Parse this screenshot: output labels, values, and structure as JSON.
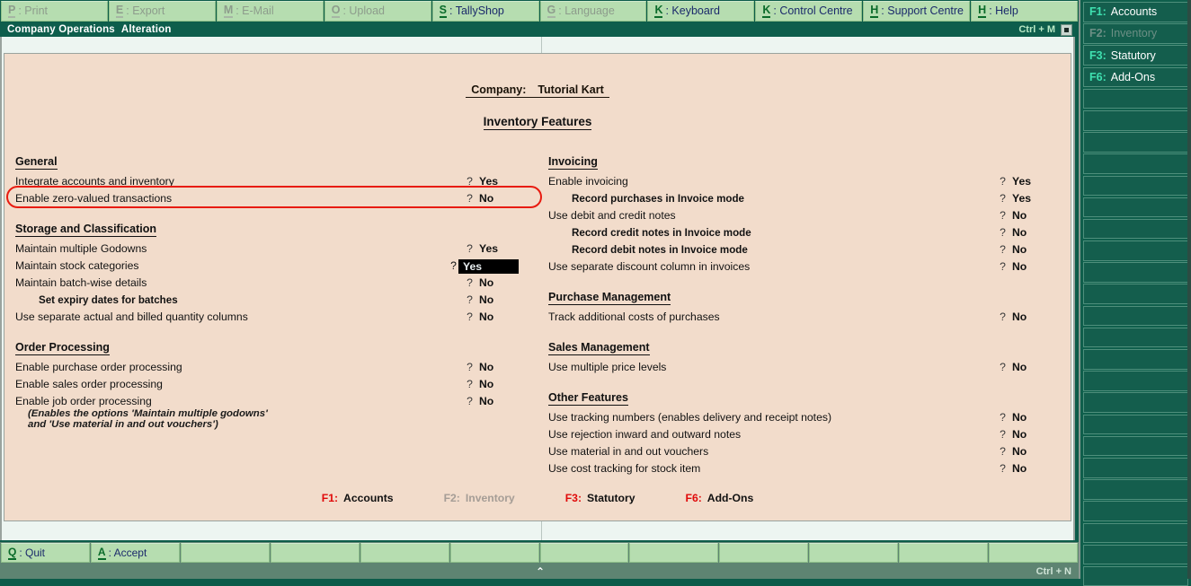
{
  "menubar": [
    {
      "acc": "P",
      "rest": ": Print",
      "enabled": false
    },
    {
      "acc": "E",
      "rest": ": Export",
      "enabled": false
    },
    {
      "acc": "M",
      "rest": ": E-Mail",
      "enabled": false
    },
    {
      "acc": "O",
      "rest": ": Upload",
      "enabled": false
    },
    {
      "acc": "S",
      "rest": ": TallyShop",
      "enabled": true
    },
    {
      "acc": "G",
      "rest": ": Language",
      "enabled": false
    },
    {
      "acc": "K",
      "rest": ": Keyboard",
      "enabled": true
    },
    {
      "acc": "K",
      "rest": ": Control Centre",
      "enabled": true
    },
    {
      "acc": "H",
      "rest": ": Support Centre",
      "enabled": true
    },
    {
      "acc": "H",
      "rest": ": Help",
      "enabled": true
    }
  ],
  "titlebar": {
    "title_part1": "Company Operations",
    "title_part2": "Alteration",
    "shortcut": "Ctrl + M"
  },
  "header": {
    "company_label": "Company:",
    "company_name": "Tutorial Kart",
    "page_title": "Inventory Features"
  },
  "left_column": [
    {
      "kind": "section",
      "label": "General"
    },
    {
      "kind": "row",
      "label": "Integrate accounts and inventory",
      "value": "Yes"
    },
    {
      "kind": "row",
      "label": "Enable zero-valued transactions",
      "value": "No"
    },
    {
      "kind": "gap"
    },
    {
      "kind": "section",
      "label": "Storage and Classification"
    },
    {
      "kind": "row",
      "label": "Maintain multiple Godowns",
      "value": "Yes"
    },
    {
      "kind": "row",
      "label": "Maintain stock categories",
      "value": "Yes",
      "selected": true
    },
    {
      "kind": "row",
      "label": "Maintain batch-wise details",
      "value": "No"
    },
    {
      "kind": "row",
      "label": "Set expiry dates for batches",
      "value": "No",
      "indent": true
    },
    {
      "kind": "row",
      "label": "Use separate actual and billed quantity columns",
      "value": "No"
    },
    {
      "kind": "gap"
    },
    {
      "kind": "section",
      "label": "Order Processing"
    },
    {
      "kind": "row",
      "label": "Enable purchase order processing",
      "value": "No"
    },
    {
      "kind": "row",
      "label": "Enable sales order processing",
      "value": "No"
    },
    {
      "kind": "row",
      "label": "Enable job order processing",
      "value": "No"
    },
    {
      "kind": "note",
      "label": "(Enables the options 'Maintain multiple godowns'"
    },
    {
      "kind": "note",
      "label": "and 'Use material in and out vouchers')"
    }
  ],
  "right_column": [
    {
      "kind": "section",
      "label": "Invoicing"
    },
    {
      "kind": "row",
      "label": "Enable invoicing",
      "value": "Yes"
    },
    {
      "kind": "row",
      "label": "Record purchases in Invoice mode",
      "value": "Yes",
      "indent": true
    },
    {
      "kind": "row",
      "label": "Use debit and credit notes",
      "value": "No"
    },
    {
      "kind": "row",
      "label": "Record credit notes in Invoice mode",
      "value": "No",
      "indent": true
    },
    {
      "kind": "row",
      "label": "Record debit notes in Invoice mode",
      "value": "No",
      "indent": true
    },
    {
      "kind": "row",
      "label": "Use separate discount column in invoices",
      "value": "No"
    },
    {
      "kind": "gap"
    },
    {
      "kind": "section",
      "label": "Purchase Management"
    },
    {
      "kind": "row",
      "label": "Track additional costs of purchases",
      "value": "No"
    },
    {
      "kind": "gap"
    },
    {
      "kind": "section",
      "label": "Sales Management"
    },
    {
      "kind": "row",
      "label": "Use multiple price levels",
      "value": "No"
    },
    {
      "kind": "gap"
    },
    {
      "kind": "section",
      "label": "Other Features"
    },
    {
      "kind": "row",
      "label": "Use tracking numbers (enables delivery and receipt notes)",
      "value": "No"
    },
    {
      "kind": "row",
      "label": "Use rejection inward and outward notes",
      "value": "No"
    },
    {
      "kind": "row",
      "label": "Use material in and out vouchers",
      "value": "No"
    },
    {
      "kind": "row",
      "label": "Use cost tracking for stock item",
      "value": "No"
    }
  ],
  "fkey_strip": [
    {
      "key": "F1:",
      "label": "Accounts",
      "enabled": true
    },
    {
      "key": "F2:",
      "label": "Inventory",
      "enabled": false
    },
    {
      "key": "F3:",
      "label": "Statutory",
      "enabled": true
    },
    {
      "key": "F6:",
      "label": "Add-Ons",
      "enabled": true
    }
  ],
  "bottom_buttons": [
    {
      "acc": "Q",
      "rest": ": Quit"
    },
    {
      "acc": "A",
      "rest": ": Accept"
    },
    {
      "acc": "",
      "rest": ""
    },
    {
      "acc": "",
      "rest": ""
    },
    {
      "acc": "",
      "rest": ""
    },
    {
      "acc": "",
      "rest": ""
    },
    {
      "acc": "",
      "rest": ""
    },
    {
      "acc": "",
      "rest": ""
    },
    {
      "acc": "",
      "rest": ""
    },
    {
      "acc": "",
      "rest": ""
    },
    {
      "acc": "",
      "rest": ""
    },
    {
      "acc": "",
      "rest": ""
    }
  ],
  "statusbar": {
    "caret": "⌃",
    "shortcut": "Ctrl + N"
  },
  "sidebar": [
    {
      "acc": "F1:",
      "label": "Accounts",
      "enabled": true
    },
    {
      "acc": "F2:",
      "label": "Inventory",
      "enabled": false
    },
    {
      "acc": "F3:",
      "label": "Statutory",
      "enabled": true
    },
    {
      "acc": "F6:",
      "label": "Add-Ons",
      "enabled": true
    },
    {
      "acc": "",
      "label": "",
      "enabled": true
    },
    {
      "acc": "",
      "label": "",
      "enabled": true
    },
    {
      "acc": "",
      "label": "",
      "enabled": true
    },
    {
      "acc": "",
      "label": "",
      "enabled": true
    },
    {
      "acc": "",
      "label": "",
      "enabled": true
    },
    {
      "acc": "",
      "label": "",
      "enabled": true
    },
    {
      "acc": "",
      "label": "",
      "enabled": true
    },
    {
      "acc": "",
      "label": "",
      "enabled": true
    },
    {
      "acc": "",
      "label": "",
      "enabled": true
    },
    {
      "acc": "",
      "label": "",
      "enabled": true
    },
    {
      "acc": "",
      "label": "",
      "enabled": true
    },
    {
      "acc": "",
      "label": "",
      "enabled": true
    },
    {
      "acc": "",
      "label": "",
      "enabled": true
    },
    {
      "acc": "",
      "label": "",
      "enabled": true
    },
    {
      "acc": "",
      "label": "",
      "enabled": true
    },
    {
      "acc": "",
      "label": "",
      "enabled": true
    },
    {
      "acc": "",
      "label": "",
      "enabled": true
    },
    {
      "acc": "",
      "label": "",
      "enabled": true
    },
    {
      "acc": "",
      "label": "",
      "enabled": true
    },
    {
      "acc": "",
      "label": "",
      "enabled": true
    },
    {
      "acc": "",
      "label": "",
      "enabled": true
    },
    {
      "acc": "",
      "label": "",
      "enabled": true
    },
    {
      "acc": "",
      "label": "",
      "enabled": true
    }
  ],
  "colors": {
    "chrome_green": "#0d5c4a",
    "menu_cell": "#b6ddb0",
    "panel_bg": "#f2dccb",
    "work_bg": "#edf5f1",
    "highlight_red": "#e81b10",
    "accel_green": "#0a6b2a",
    "fkey_red": "#e00a0a",
    "sidebar_accent": "#3fe0b0"
  }
}
